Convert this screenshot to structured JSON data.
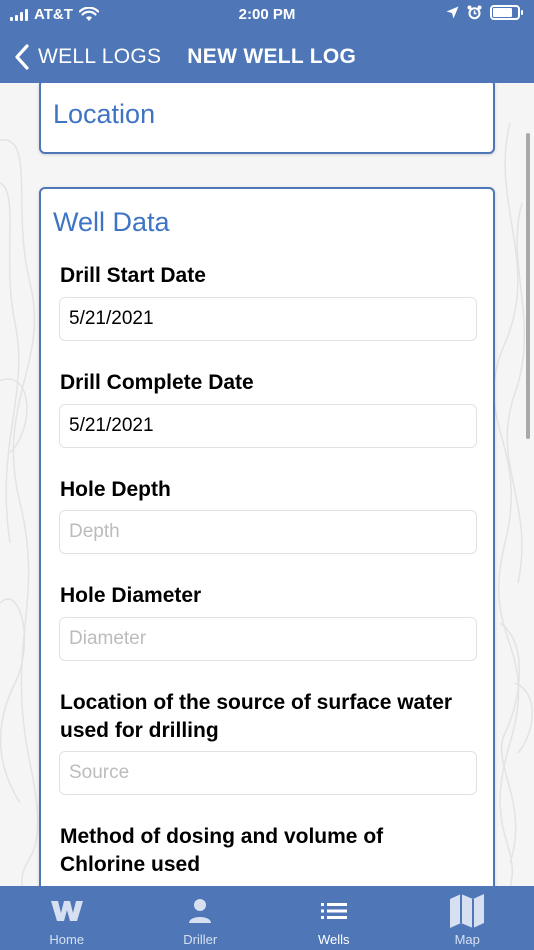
{
  "status_bar": {
    "carrier": "AT&T",
    "time": "2:00 PM"
  },
  "nav": {
    "back_label": "WELL LOGS",
    "title": "NEW WELL LOG"
  },
  "location_card": {
    "title": "Location"
  },
  "well_data_card": {
    "title": "Well Data",
    "fields": [
      {
        "label": "Drill Start Date",
        "value": "5/21/2021",
        "placeholder": ""
      },
      {
        "label": "Drill Complete Date",
        "value": "5/21/2021",
        "placeholder": ""
      },
      {
        "label": "Hole Depth",
        "value": "",
        "placeholder": "Depth"
      },
      {
        "label": "Hole Diameter",
        "value": "",
        "placeholder": "Diameter"
      },
      {
        "label_line1": "Location of the source of surface water",
        "label_line2": "used for drilling",
        "value": "",
        "placeholder": "Source"
      },
      {
        "label_line1": "Method of dosing and volume of",
        "label_line2": "Chlorine used"
      }
    ]
  },
  "tabs": [
    {
      "label": "Home",
      "icon": "home-w-logo-icon",
      "active": false
    },
    {
      "label": "Driller",
      "icon": "person-icon",
      "active": false
    },
    {
      "label": "Wells",
      "icon": "list-icon",
      "active": true
    },
    {
      "label": "Map",
      "icon": "map-icon",
      "active": false
    }
  ],
  "colors": {
    "brand": "#4f77b8",
    "card_title": "#3f74c4"
  }
}
